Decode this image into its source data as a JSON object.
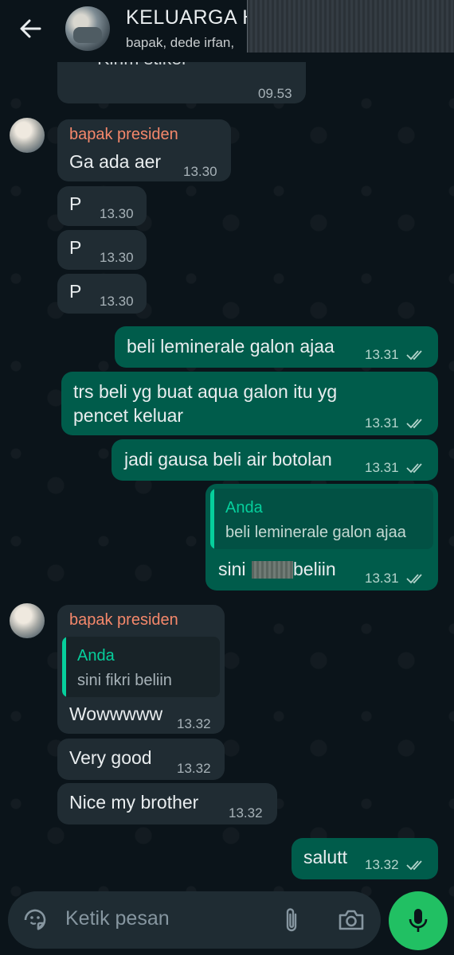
{
  "header": {
    "title": "KELUARGA H",
    "subtitle": "bapak, dede irfan,"
  },
  "messages": {
    "m0": {
      "text": "Kirim stiker",
      "time": "09.53"
    },
    "m1": {
      "sender": "bapak presiden",
      "text": "Ga ada aer",
      "time": "13.30"
    },
    "m2": {
      "text": "P",
      "time": "13.30"
    },
    "m3": {
      "text": "P",
      "time": "13.30"
    },
    "m4": {
      "text": "P",
      "time": "13.30"
    },
    "m5": {
      "text": "beli leminerale galon ajaa",
      "time": "13.31"
    },
    "m6": {
      "line1": "trs beli yg buat aqua galon itu yg",
      "line2": "pencet keluar",
      "time": "13.31"
    },
    "m7": {
      "text": "jadi gausa beli air botolan",
      "time": "13.31"
    },
    "m8": {
      "quote_name": "Anda",
      "quote_text": "beli leminerale galon ajaa",
      "text_start": "sini",
      "text_end": "beliin",
      "time": "13.31"
    },
    "m9": {
      "sender": "bapak presiden",
      "quote_name": "Anda",
      "quote_text": "sini fikri beliin",
      "text": "Wowwwww",
      "time": "13.32"
    },
    "m10": {
      "text": "Very good",
      "time": "13.32"
    },
    "m11": {
      "text": "Nice my brother",
      "time": "13.32"
    },
    "m12": {
      "text": "salutt",
      "time": "13.32"
    }
  },
  "input": {
    "placeholder": "Ketik pesan"
  },
  "icons": {
    "back": "arrow-left-icon",
    "sticker": "sticker-icon",
    "attach": "paperclip-icon",
    "camera": "camera-icon",
    "mic": "microphone-icon",
    "read_receipt": "double-check-icon"
  },
  "colors": {
    "background": "#0b141a",
    "incoming_bubble": "#202c33",
    "outgoing_bubble": "#005c4b",
    "sender_name": "#f5886b",
    "accent": "#21c063",
    "quote_name": "#06cf9c"
  }
}
